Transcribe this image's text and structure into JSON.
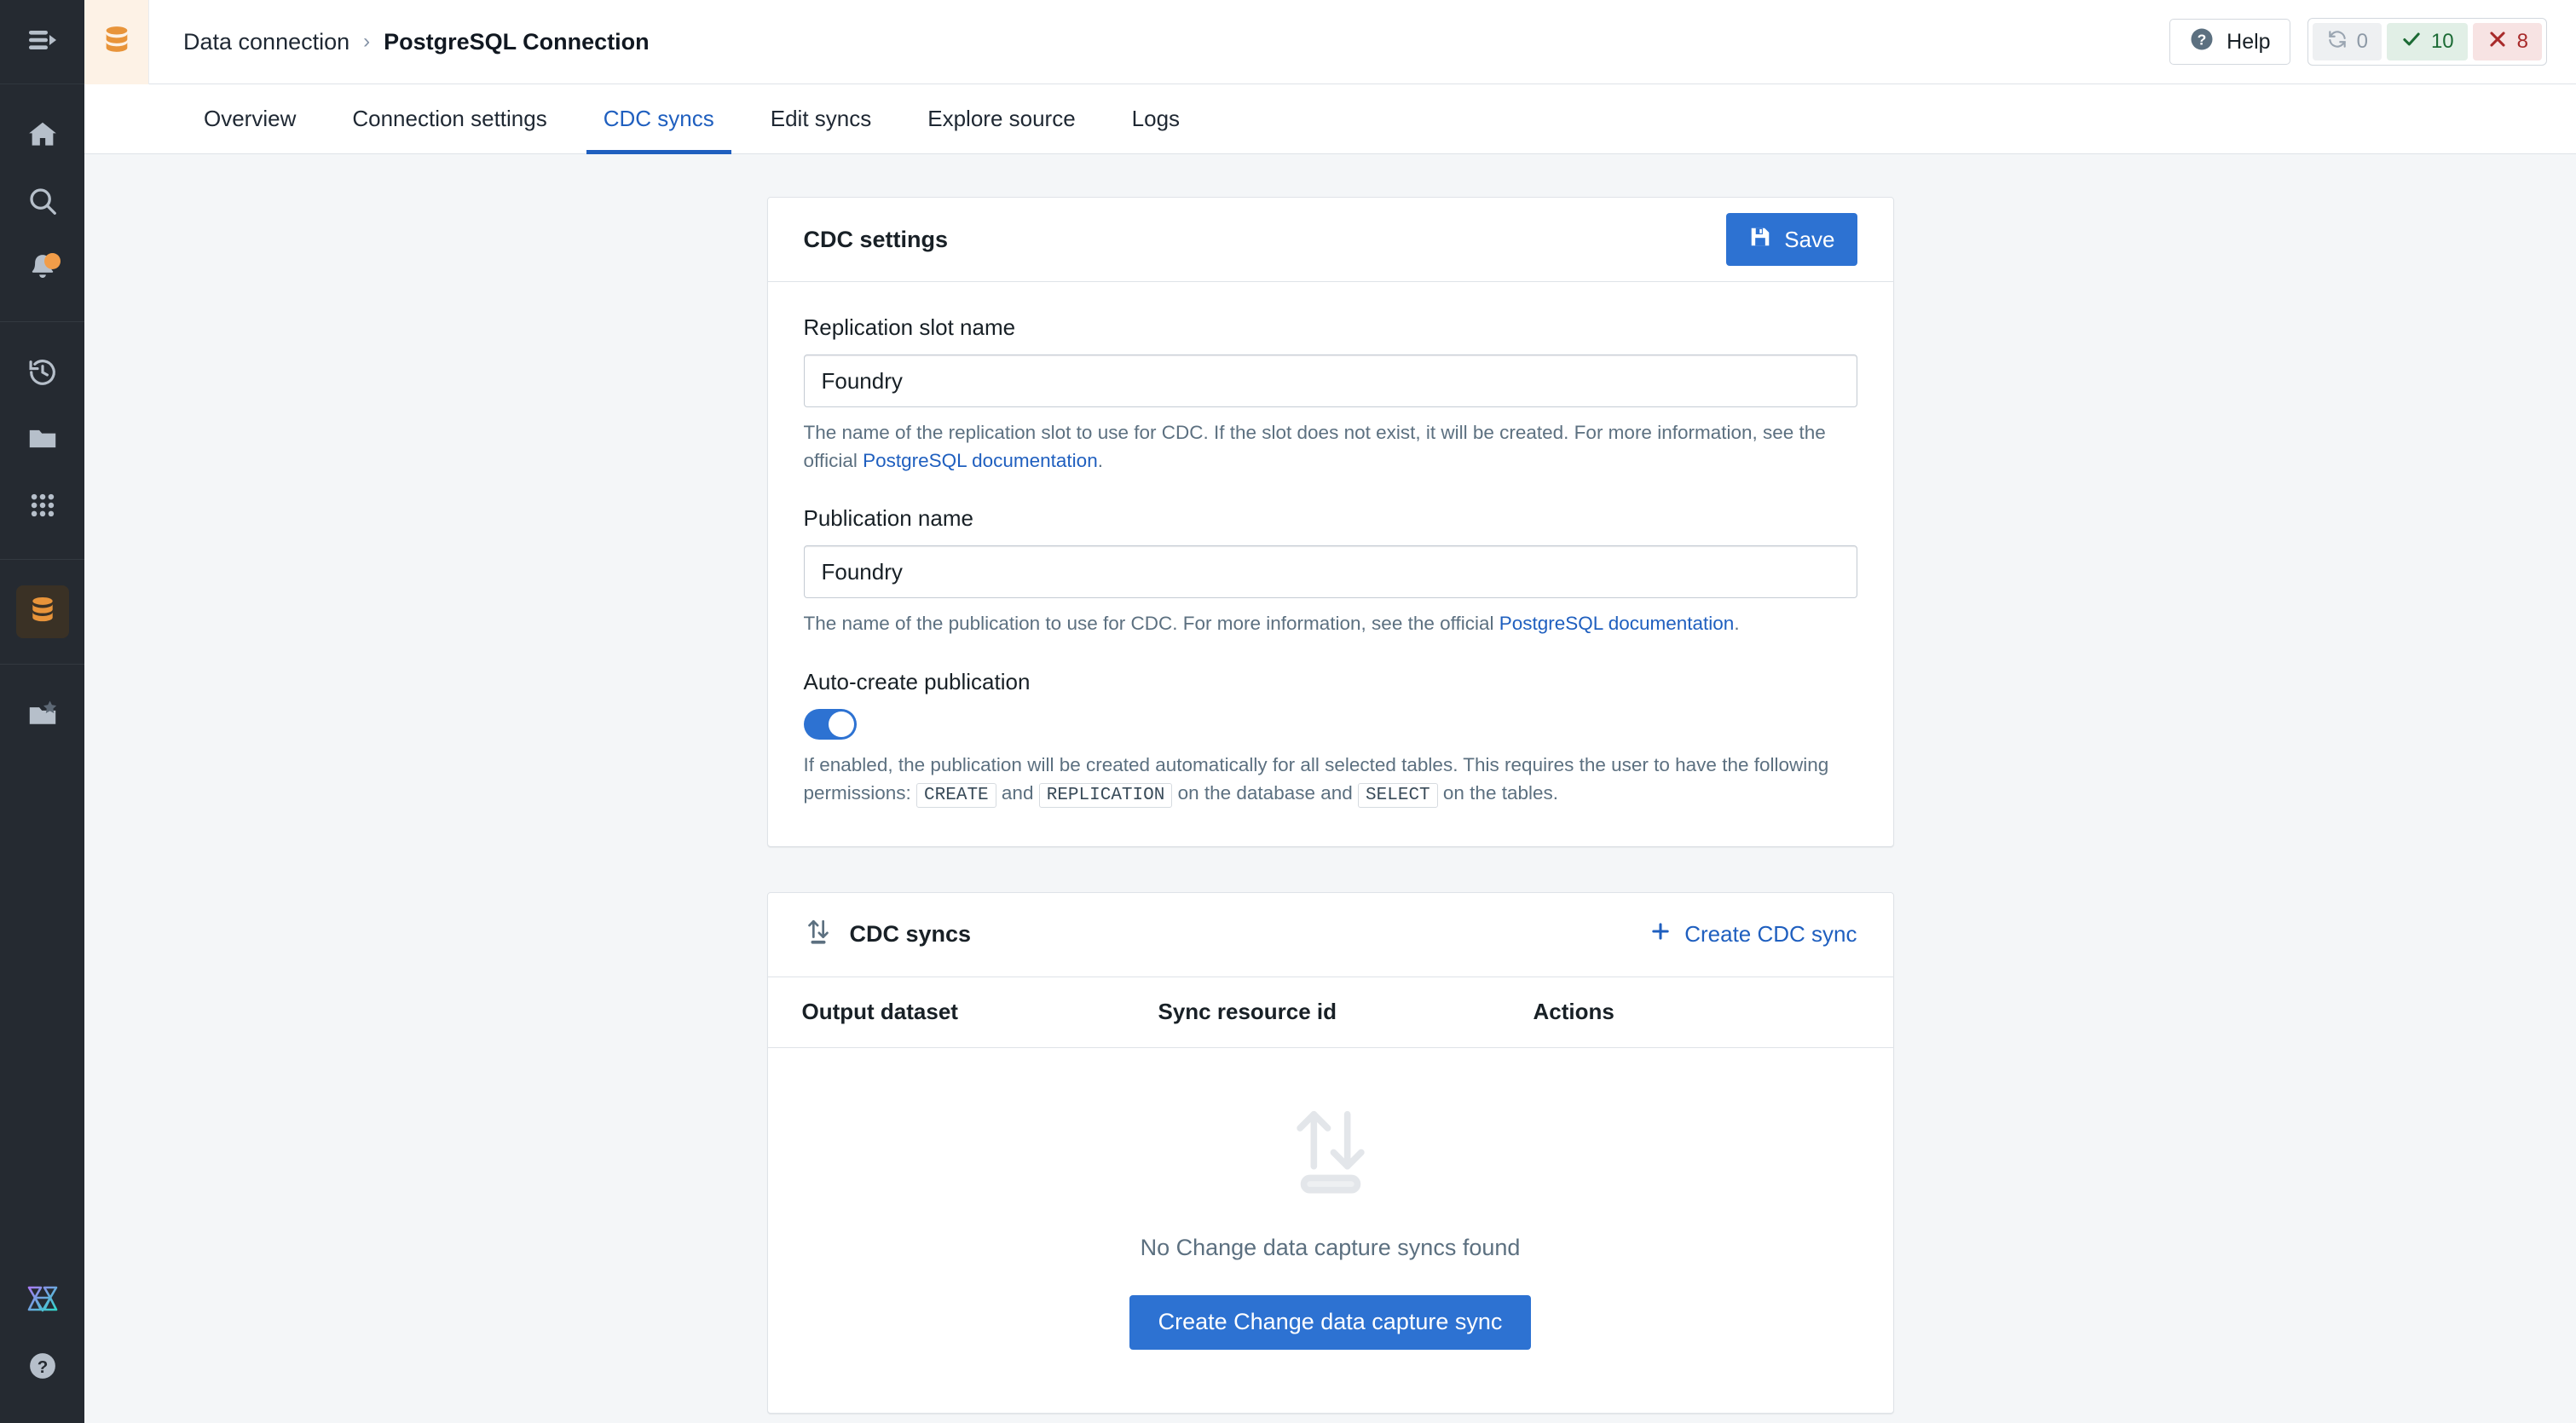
{
  "rail": {
    "toggle": {
      "icon": "menu-expand-icon"
    },
    "group1": [
      {
        "name": "home-icon",
        "label": "Home"
      },
      {
        "name": "search-icon",
        "label": "Search"
      },
      {
        "name": "notifications-icon",
        "label": "Notifications",
        "badge": true
      }
    ],
    "group2": [
      {
        "name": "history-icon",
        "label": "Recent"
      },
      {
        "name": "folder-icon",
        "label": "Projects"
      },
      {
        "name": "apps-grid-icon",
        "label": "Applications"
      }
    ],
    "group3": [
      {
        "name": "database-icon",
        "label": "Data connection",
        "active": true
      }
    ],
    "group4": [
      {
        "name": "folder-star-icon",
        "label": "Favorites"
      }
    ],
    "bottom": [
      {
        "name": "aip-logo-icon",
        "label": "AIP"
      },
      {
        "name": "help-circle-icon",
        "label": "Help"
      }
    ]
  },
  "topbar": {
    "app_icon": "database-icon",
    "breadcrumb": {
      "parent": "Data connection",
      "separator": "›",
      "current": "PostgreSQL Connection"
    },
    "help_label": "Help",
    "help_icon": "help-circle-icon",
    "status": [
      {
        "name": "syncing",
        "icon": "refresh-icon",
        "count": "0",
        "tone": "neutral"
      },
      {
        "name": "succeeded",
        "icon": "check-icon",
        "count": "10",
        "tone": "ok"
      },
      {
        "name": "failed",
        "icon": "close-icon",
        "count": "8",
        "tone": "error"
      }
    ]
  },
  "tabs": [
    {
      "label": "Overview",
      "active": false
    },
    {
      "label": "Connection settings",
      "active": false
    },
    {
      "label": "CDC syncs",
      "active": true
    },
    {
      "label": "Edit syncs",
      "active": false
    },
    {
      "label": "Explore source",
      "active": false
    },
    {
      "label": "Logs",
      "active": false
    }
  ],
  "cdc_settings": {
    "title": "CDC settings",
    "save_label": "Save",
    "save_icon": "floppy-save-icon",
    "replication_slot": {
      "label": "Replication slot name",
      "value": "Foundry",
      "help_prefix": "The name of the replication slot to use for CDC. If the slot does not exist, it will be created. For more information, see the official ",
      "help_link": "PostgreSQL documentation",
      "help_suffix": "."
    },
    "publication": {
      "label": "Publication name",
      "value": "Foundry",
      "help_prefix": "The name of the publication to use for CDC. For more information, see the official ",
      "help_link": "PostgreSQL documentation",
      "help_suffix": "."
    },
    "auto_create": {
      "label": "Auto-create publication",
      "enabled": true,
      "help_part1": "If enabled, the publication will be created automatically for all selected tables. This requires the user to have the following permissions: ",
      "code1": "CREATE",
      "help_part2": " and ",
      "code2": "REPLICATION",
      "help_part3": " on the database and ",
      "code3": "SELECT",
      "help_part4": " on the tables."
    }
  },
  "cdc_syncs": {
    "title": "CDC syncs",
    "title_icon": "sync-arrows-icon",
    "create_label": "Create CDC sync",
    "create_icon": "plus-icon",
    "columns": [
      "Output dataset",
      "Sync resource id",
      "Actions"
    ],
    "rows": [],
    "empty": {
      "icon": "sync-arrows-large-icon",
      "message": "No Change data capture syncs found",
      "button_label": "Create Change data capture sync"
    }
  },
  "colors": {
    "accent": "#2d72d2",
    "link": "#1f5fbf",
    "brand_orange": "#e8943a",
    "rail_bg": "#252a31",
    "page_bg": "#f4f6f8",
    "success": "#1c6b35",
    "error": "#a82a2a"
  }
}
